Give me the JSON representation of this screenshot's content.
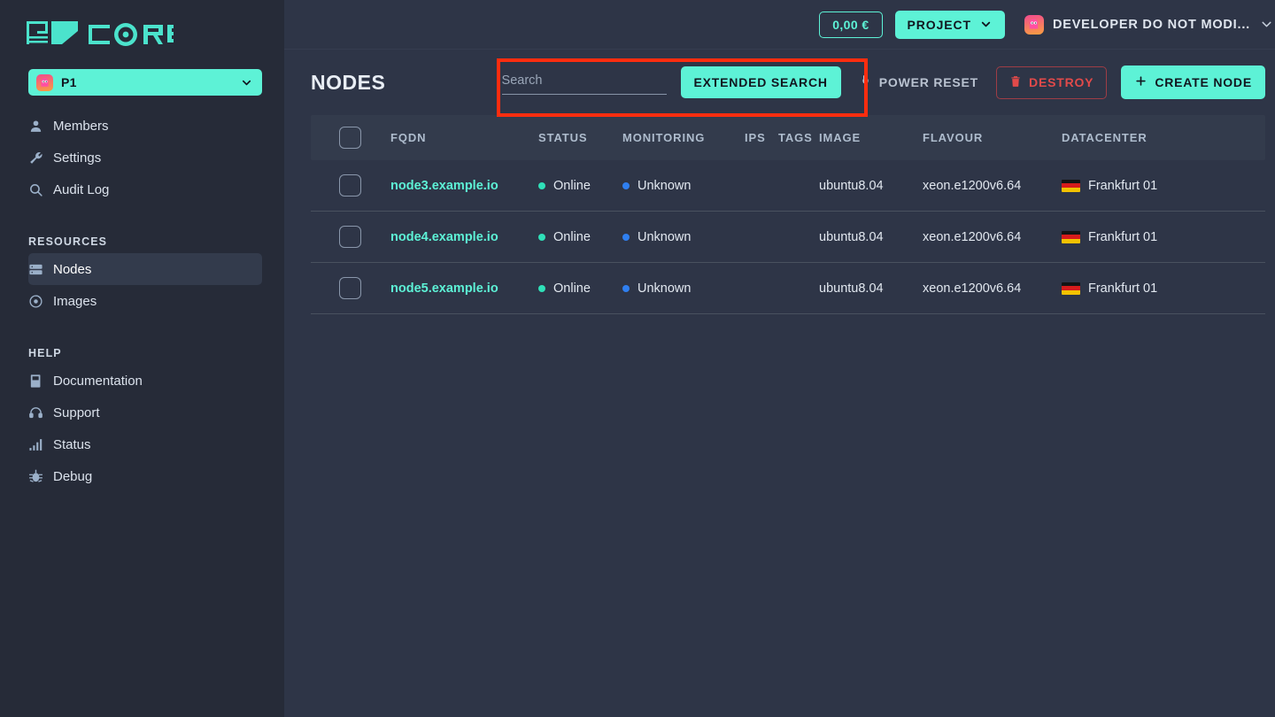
{
  "brand": {
    "logo_text": "CORE",
    "accent": "#5df2d6"
  },
  "sidebar": {
    "project_selector": {
      "label": "P1",
      "icon": "ghost-avatar-icon",
      "chevron": "chevron-down-icon"
    },
    "nav": [
      {
        "label": "Members",
        "icon": "user-icon",
        "active": false
      },
      {
        "label": "Settings",
        "icon": "wrench-icon",
        "active": false
      },
      {
        "label": "Audit Log",
        "icon": "search-icon",
        "active": false
      }
    ],
    "resources_title": "RESOURCES",
    "resources": [
      {
        "label": "Nodes",
        "icon": "server-icon",
        "active": true
      },
      {
        "label": "Images",
        "icon": "disc-icon",
        "active": false
      }
    ],
    "help_title": "HELP",
    "help": [
      {
        "label": "Documentation",
        "icon": "book-icon",
        "active": false
      },
      {
        "label": "Support",
        "icon": "headset-icon",
        "active": false
      },
      {
        "label": "Status",
        "icon": "bar-chart-icon",
        "active": false
      },
      {
        "label": "Debug",
        "icon": "bug-icon",
        "active": false
      }
    ]
  },
  "topbar": {
    "credit": "0,00 €",
    "project_button": "PROJECT",
    "project_chevron": "chevron-down-icon",
    "user_name": "DEVELOPER DO NOT MODI...",
    "user_avatar": "ghost-avatar-icon",
    "user_chevron": "chevron-down-icon"
  },
  "page": {
    "title": "NODES",
    "search": {
      "value": "",
      "placeholder": "Search"
    },
    "buttons": {
      "extended_search": "EXTENDED SEARCH",
      "power_reset": "POWER RESET",
      "destroy": "DESTROY",
      "create_node": "CREATE NODE"
    },
    "icons": {
      "power_reset": "power-plug-icon",
      "destroy": "trash-icon",
      "create_node": "plus-icon"
    },
    "highlight_color": "#ff2d0f"
  },
  "table": {
    "columns": [
      "FQDN",
      "STATUS",
      "MONITORING",
      "IPS",
      "TAGS",
      "IMAGE",
      "FLAVOUR",
      "DATACENTER"
    ],
    "rows": [
      {
        "fqdn": "node3.example.io",
        "status": "Online",
        "status_color": "#2fe0b8",
        "monitoring": "Unknown",
        "monitoring_color": "#2f7ff0",
        "ips": "",
        "tags": "",
        "image": "ubuntu8.04",
        "flavour": "xeon.e1200v6.64",
        "datacenter": "Frankfurt 01",
        "flag": "de-flag-icon"
      },
      {
        "fqdn": "node4.example.io",
        "status": "Online",
        "status_color": "#2fe0b8",
        "monitoring": "Unknown",
        "monitoring_color": "#2f7ff0",
        "ips": "",
        "tags": "",
        "image": "ubuntu8.04",
        "flavour": "xeon.e1200v6.64",
        "datacenter": "Frankfurt 01",
        "flag": "de-flag-icon"
      },
      {
        "fqdn": "node5.example.io",
        "status": "Online",
        "status_color": "#2fe0b8",
        "monitoring": "Unknown",
        "monitoring_color": "#2f7ff0",
        "ips": "",
        "tags": "",
        "image": "ubuntu8.04",
        "flavour": "xeon.e1200v6.64",
        "datacenter": "Frankfurt 01",
        "flag": "de-flag-icon"
      }
    ]
  }
}
